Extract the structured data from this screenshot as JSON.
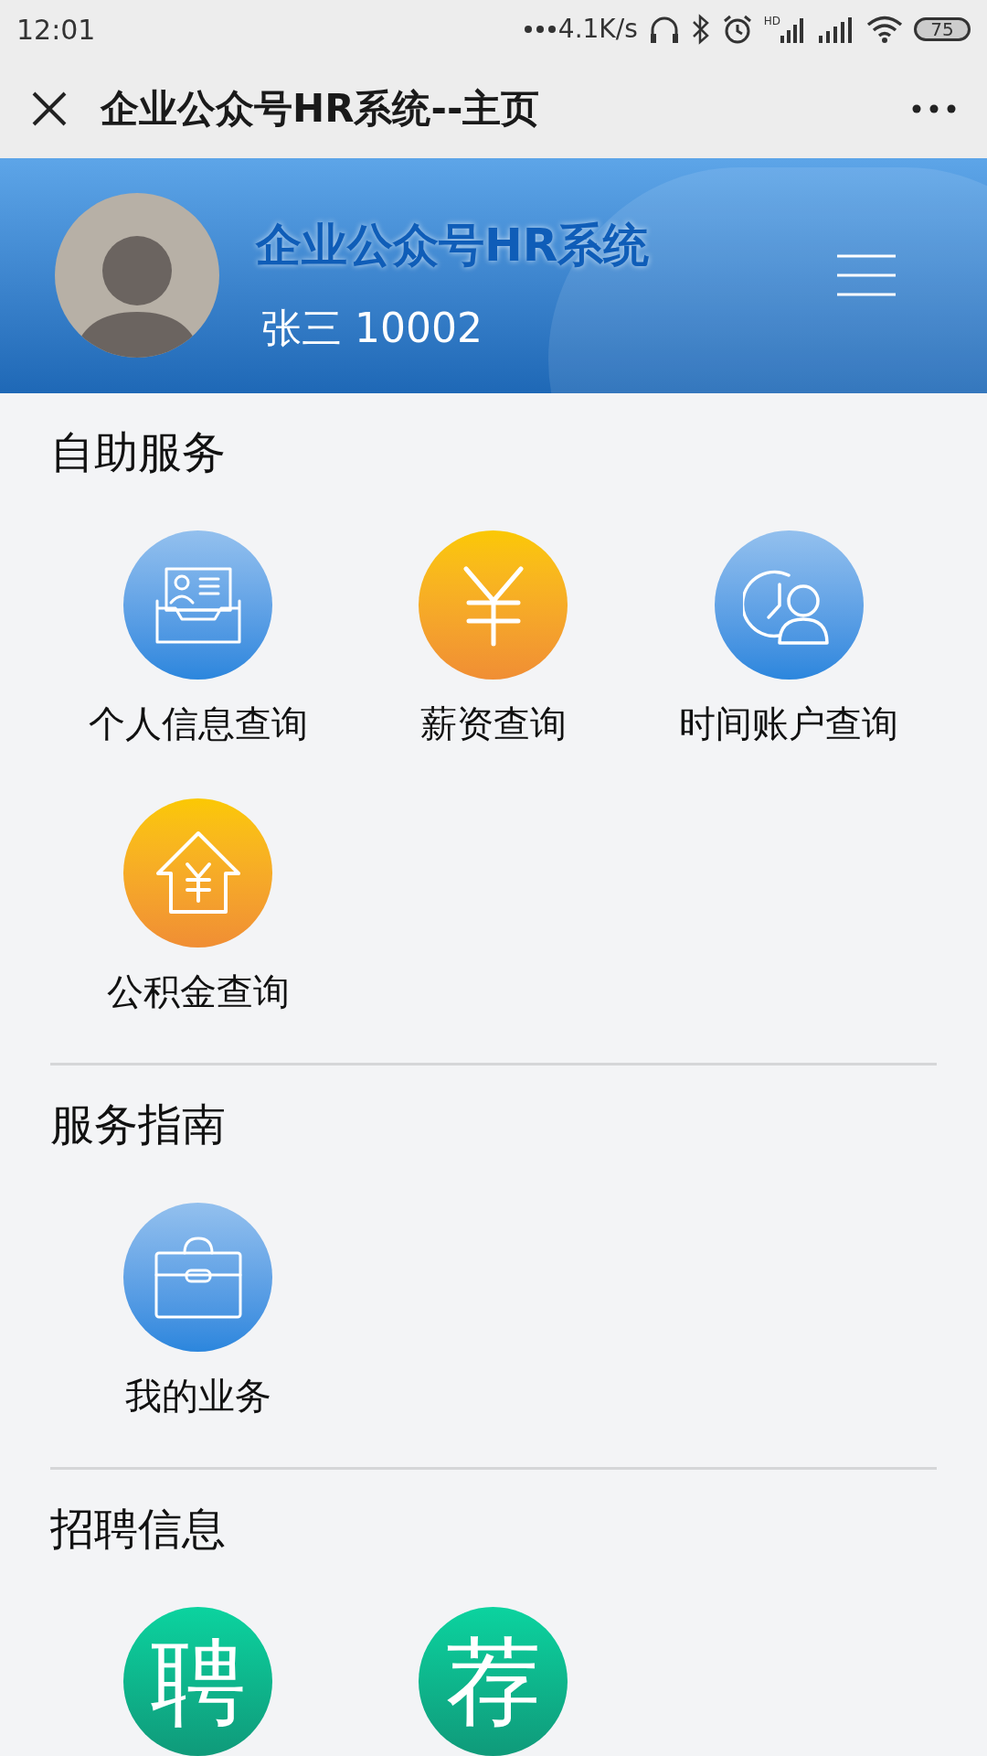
{
  "status_bar": {
    "time": "12:01",
    "speed": "4.1K/s",
    "hd": "HD",
    "battery": "75"
  },
  "nav_bar": {
    "title": "企业公众号HR系统--主页"
  },
  "header": {
    "app_name": "企业公众号HR系统",
    "user": "张三 10002"
  },
  "sections": [
    {
      "title": "自助服务",
      "items": [
        {
          "kind": "profile",
          "label": "个人信息查询"
        },
        {
          "kind": "salary",
          "label": "薪资查询"
        },
        {
          "kind": "clock",
          "label": "时间账户查询"
        },
        {
          "kind": "house",
          "label": "公积金查询"
        }
      ]
    },
    {
      "title": "服务指南",
      "items": [
        {
          "kind": "briefcase",
          "label": "我的业务"
        }
      ]
    },
    {
      "title": "招聘信息",
      "items": [
        {
          "kind": "glyph",
          "glyph": "聘"
        },
        {
          "kind": "glyph",
          "glyph": "荐"
        }
      ]
    }
  ]
}
